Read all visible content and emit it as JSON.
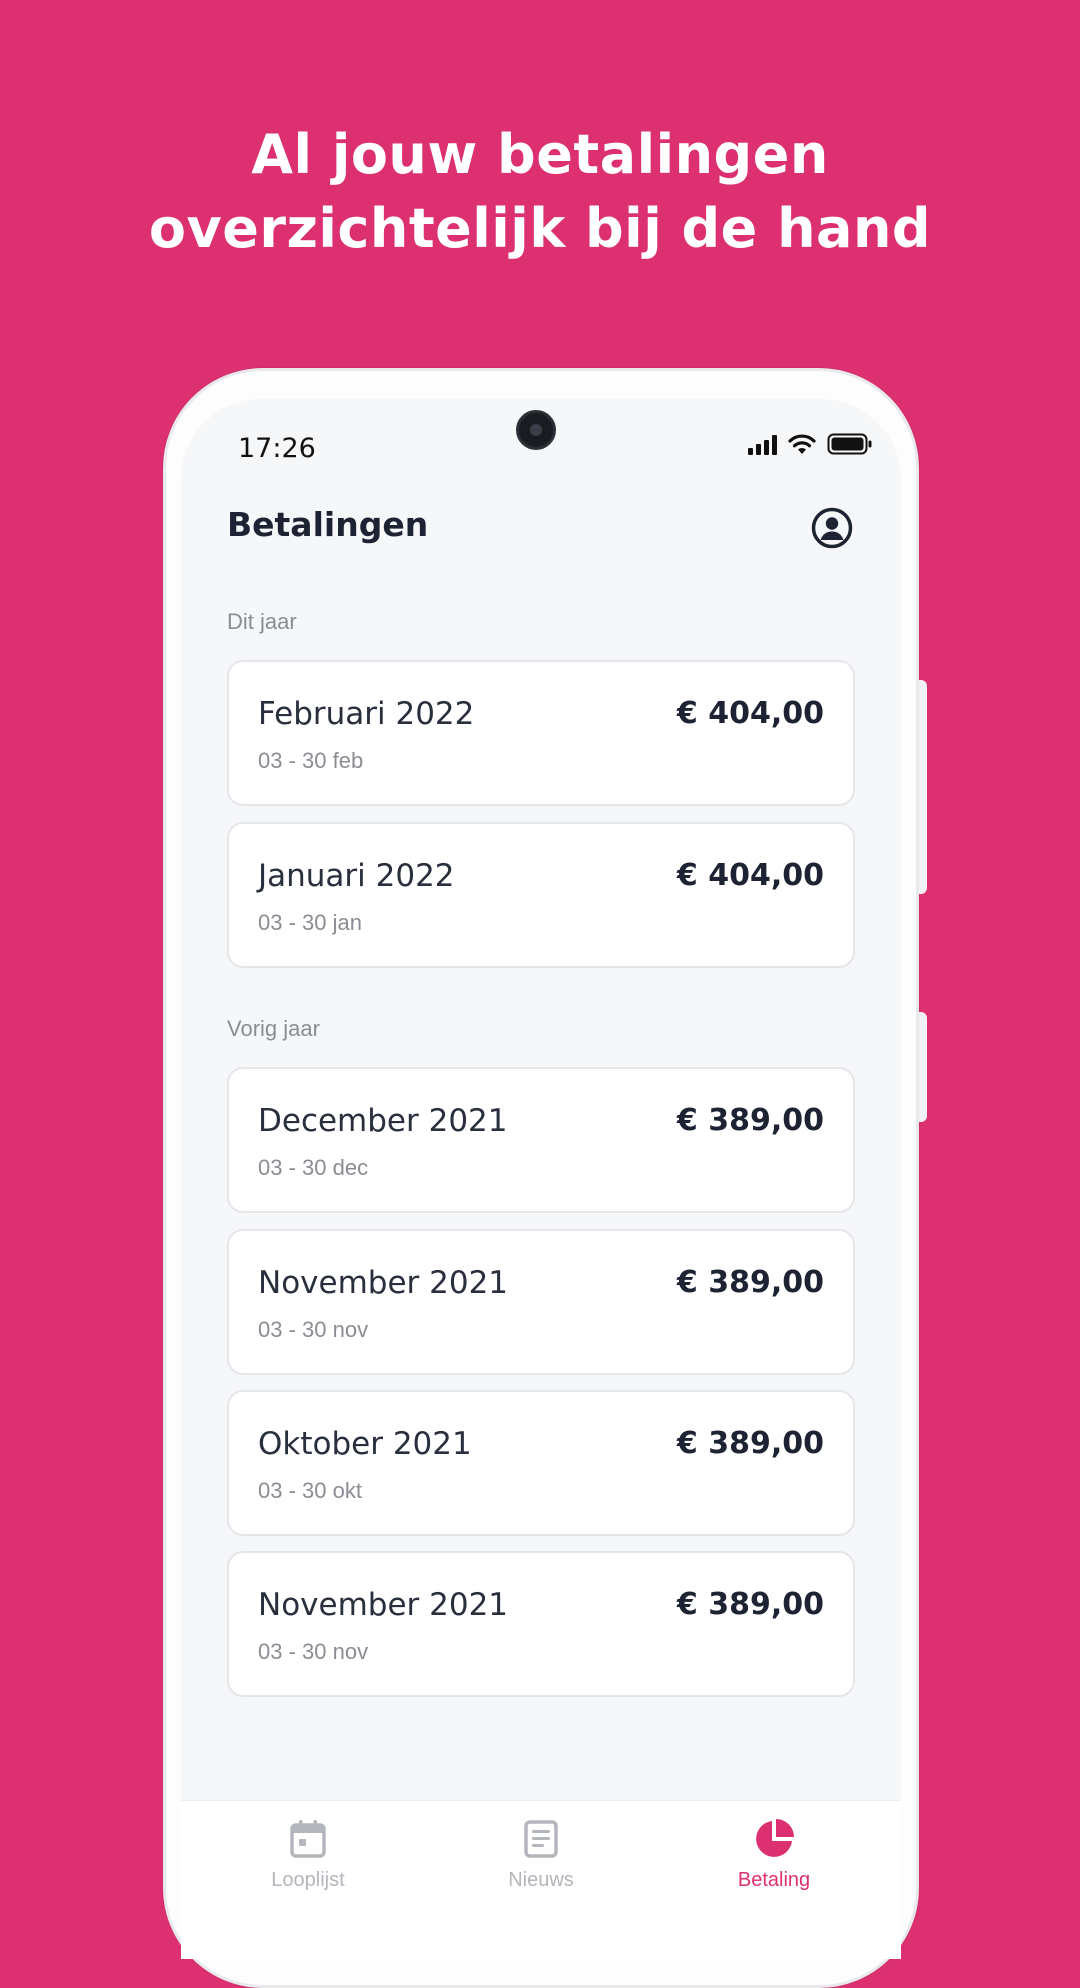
{
  "headline": {
    "line1": "Al jouw betalingen",
    "line2": "overzichtelijk bij de hand"
  },
  "status_bar": {
    "time": "17:26",
    "icons": [
      "signal-icon",
      "wifi-icon",
      "battery-icon"
    ]
  },
  "header": {
    "title": "Betalingen",
    "profile_icon": "account-circle-icon"
  },
  "sections": [
    {
      "label": "Dit jaar",
      "payments": [
        {
          "month": "Februari 2022",
          "range": "03 - 30 feb",
          "amount": "€ 404,00"
        },
        {
          "month": "Januari 2022",
          "range": "03 - 30 jan",
          "amount": "€ 404,00"
        }
      ]
    },
    {
      "label": "Vorig jaar",
      "payments": [
        {
          "month": "December 2021",
          "range": "03 - 30 dec",
          "amount": "€ 389,00"
        },
        {
          "month": "November 2021",
          "range": "03 - 30 nov",
          "amount": "€ 389,00"
        },
        {
          "month": "Oktober 2021",
          "range": "03 - 30 okt",
          "amount": "€ 389,00"
        },
        {
          "month": "November 2021",
          "range": "03 - 30 nov",
          "amount": "€ 389,00"
        }
      ]
    }
  ],
  "tabbar": {
    "tabs": [
      {
        "label": "Looplijst",
        "icon": "calendar-icon",
        "active": false
      },
      {
        "label": "Nieuws",
        "icon": "document-icon",
        "active": false
      },
      {
        "label": "Betaling",
        "icon": "pie-chart-icon",
        "active": true
      }
    ]
  },
  "colors": {
    "brand": "#DD3071",
    "text_dark": "#1d2333",
    "text_muted": "#8a8d93",
    "inactive_tab": "#b3b6bc"
  }
}
